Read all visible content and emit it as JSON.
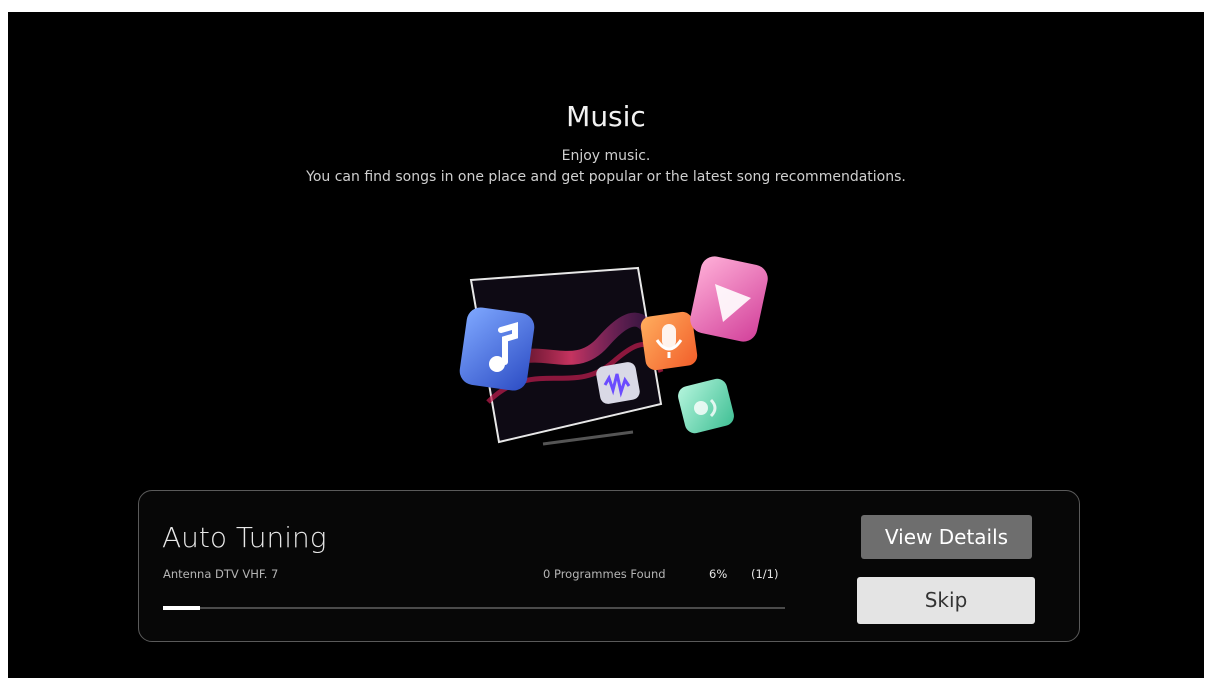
{
  "header": {
    "title": "Music",
    "subtitle_line1": "Enjoy music.",
    "subtitle_line2": "You can find songs in one place and get popular or the latest song recommendations."
  },
  "illustration": {
    "icons": [
      "tv-icon",
      "music-note-icon",
      "microphone-icon",
      "play-icon",
      "sound-wave-icon",
      "speaker-icon"
    ]
  },
  "tuning": {
    "title": "Auto Tuning",
    "channel": "Antenna DTV VHF. 7",
    "programmes_found": "0 Programmes Found",
    "percent_label": "6%",
    "page_label": "(1/1)",
    "progress": 0.06
  },
  "buttons": {
    "view_details": "View Details",
    "skip": "Skip"
  },
  "colors": {
    "background": "#000000",
    "panel_border": "#5a5a5a",
    "button_view": "#6e6e6e",
    "button_skip": "#e4e4e4"
  }
}
